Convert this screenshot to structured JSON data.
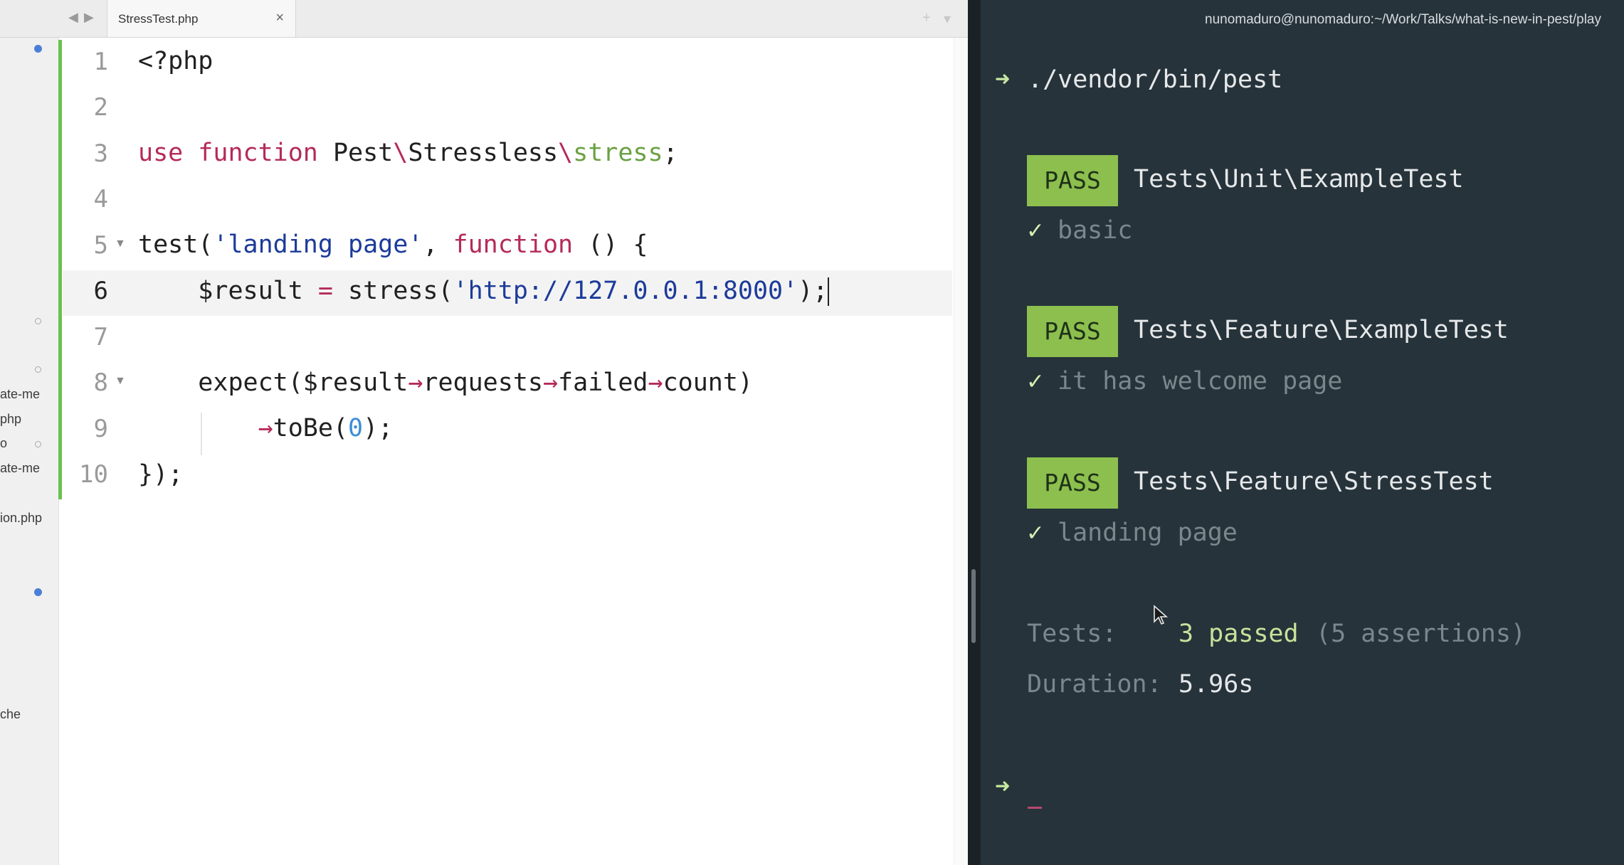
{
  "editor": {
    "tab": {
      "title": "StressTest.php",
      "close_symbol": "×"
    },
    "nav": {
      "back": "◀",
      "forward": "▶"
    },
    "tab_actions": {
      "add": "+",
      "menu": "▾"
    },
    "sidebar": {
      "items": [
        {
          "label": "ate-me"
        },
        {
          "label": "php"
        },
        {
          "label": "o"
        },
        {
          "label": "ate-me"
        },
        {
          "label": "ion.php"
        },
        {
          "label": "che"
        }
      ]
    },
    "line_numbers": [
      "1",
      "2",
      "3",
      "4",
      "5",
      "6",
      "7",
      "8",
      "9",
      "10"
    ],
    "code": {
      "line1": "<?php",
      "line3": {
        "use": "use",
        "function": "function",
        "pest": "Pest",
        "sep1": "\\",
        "stressless": "Stressless",
        "sep2": "\\",
        "stress": "stress",
        "end": ";"
      },
      "line5": {
        "test": "test(",
        "name": "'landing page'",
        "comma": ", ",
        "function": "function",
        "rest": " () {"
      },
      "line6": {
        "var": "$result",
        "eq": " = ",
        "call": "stress(",
        "url": "'http://127.0.0.1:8000'",
        "end": ");"
      },
      "line8": {
        "expect": "expect($result",
        "arrow1": "→",
        "requests": "requests",
        "arrow2": "→",
        "failed": "failed",
        "arrow3": "→",
        "count": "count)"
      },
      "line9": {
        "arrow": "→",
        "tobe": "toBe(",
        "zero": "0",
        "end": ");"
      },
      "line10": "});"
    },
    "colors": {
      "keyword": "#b52a5b",
      "string": "#1c3b9a",
      "function_name": "#6aa144",
      "number": "#3d8ed6",
      "modified_gutter": "#6cbf4e"
    }
  },
  "terminal": {
    "title": "nunomaduro@nunomaduro:~/Work/Talks/what-is-new-in-pest/play",
    "prompt_symbol": "➜",
    "command": "./vendor/bin/pest",
    "suites": [
      {
        "status": "PASS",
        "name": "Tests\\Unit\\ExampleTest",
        "check": "✓",
        "test": "basic"
      },
      {
        "status": "PASS",
        "name": "Tests\\Feature\\ExampleTest",
        "check": "✓",
        "test": "it has welcome page"
      },
      {
        "status": "PASS",
        "name": "Tests\\Feature\\StressTest",
        "check": "✓",
        "test": "landing page"
      }
    ],
    "summary": {
      "tests_label": "Tests:",
      "passed": "3 passed",
      "assertions": "(5 assertions)",
      "duration_label": "Duration:",
      "duration": "5.96s"
    },
    "colors": {
      "background": "#26333a",
      "pass_badge": "#8cbf4e",
      "passed_text": "#c6e39b"
    }
  }
}
